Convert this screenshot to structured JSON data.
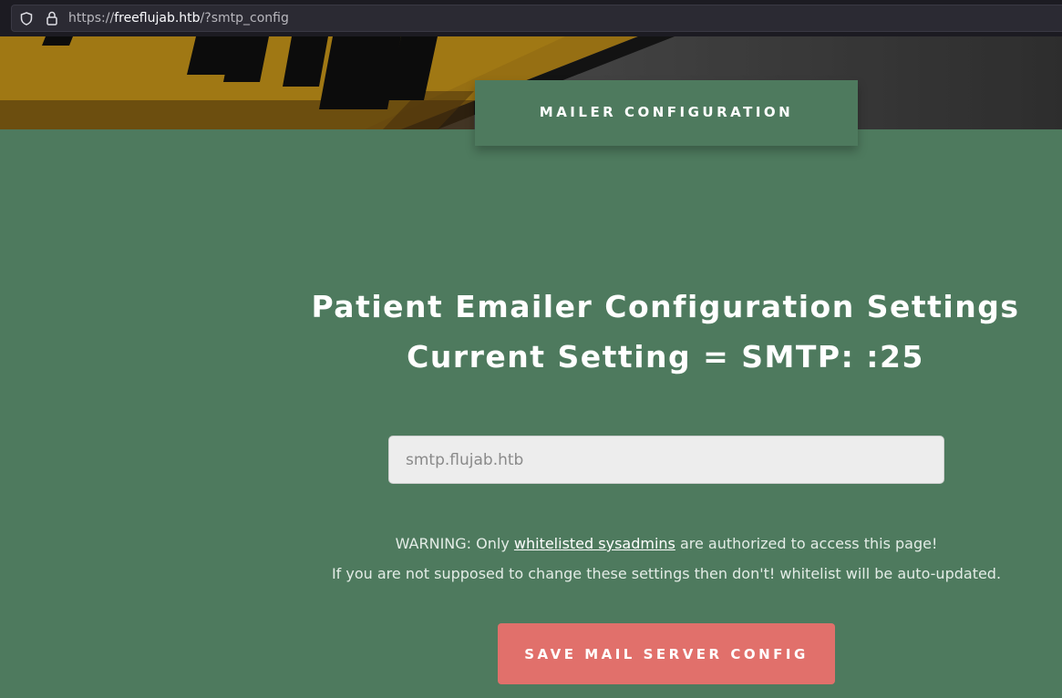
{
  "browser": {
    "url_scheme": "https://",
    "url_host": "freeflujab.htb",
    "url_path": "/?smtp_config"
  },
  "hero": {
    "sign_text": "HEAD"
  },
  "tab": {
    "label": "MAILER CONFIGURATION"
  },
  "main": {
    "title": "Patient Emailer Configuration Settings",
    "current_setting": "Current Setting = SMTP: :25",
    "smtp_input": {
      "placeholder": "smtp.flujab.htb",
      "value": ""
    },
    "warning": {
      "prefix": "WARNING: Only ",
      "link_text": "whitelisted sysadmins",
      "suffix": " are authorized to access this page!",
      "line2": "If you are not supposed to change these settings then don't! whitelist will be auto-updated."
    },
    "save_button": "SAVE MAIL SERVER CONFIG"
  },
  "colors": {
    "background": "#4e7a5e",
    "button": "#e1706b",
    "input": "#ededed"
  }
}
